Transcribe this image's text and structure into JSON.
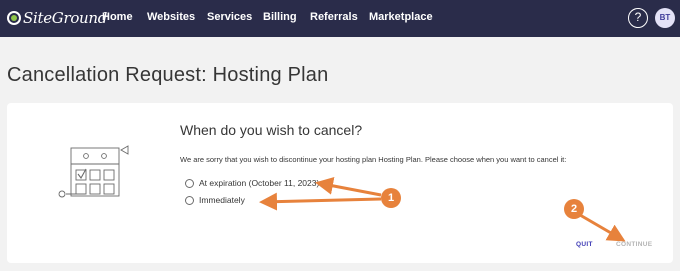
{
  "nav": {
    "brand": "SiteGround",
    "items": [
      {
        "label": "Home"
      },
      {
        "label": "Websites"
      },
      {
        "label": "Services"
      },
      {
        "label": "Billing"
      },
      {
        "label": "Referrals"
      },
      {
        "label": "Marketplace"
      }
    ],
    "help_label": "?",
    "avatar_initials": "BT"
  },
  "page": {
    "title": "Cancellation Request: Hosting Plan"
  },
  "form": {
    "question": "When do you wish to cancel?",
    "description": "We are sorry that you wish to discontinue your hosting plan Hosting Plan. Please choose when you want to cancel it:",
    "options": [
      {
        "label": "At expiration (October 11, 2023)",
        "selected": false
      },
      {
        "label": "Immediately",
        "selected": false
      }
    ],
    "quit_label": "QUIT",
    "continue_label": "CONTINUE"
  },
  "annotations": {
    "badges": [
      {
        "label": "1"
      },
      {
        "label": "2"
      }
    ],
    "color": "#e7823c"
  },
  "colors": {
    "nav_bg": "#2a2c4a",
    "accent": "#3e3bb5",
    "page_bg": "#f2f2f2",
    "disabled": "#b5b5b5"
  }
}
